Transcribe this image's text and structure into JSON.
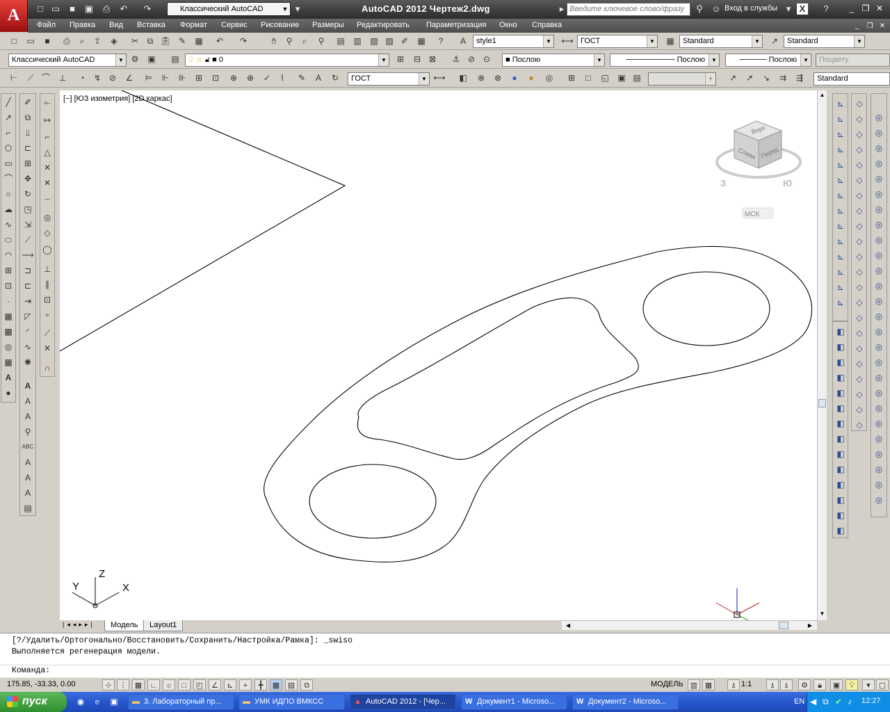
{
  "app": {
    "logo_letter": "A",
    "title": "AutoCAD 2012    Чертеж2.dwg",
    "workspace": "Классический AutoCAD",
    "search_placeholder": "Введите ключевое слово/фразу",
    "login_label": "Вход в службы"
  },
  "menu": [
    "Файл",
    "Правка",
    "Вид",
    "Вставка",
    "Формат",
    "Сервис",
    "Рисование",
    "Размеры",
    "Редактировать",
    "Параметризация",
    "Окно",
    "Справка"
  ],
  "toolbar1": {
    "text_style": "style1",
    "dim_style": "ГОСТ",
    "table_style": "Standard",
    "mleader_style": "Standard"
  },
  "toolbar2": {
    "workspace": "Классический AutoCAD",
    "layer": "0",
    "color": "Послою",
    "linetype": "Послою",
    "lineweight": "Послою",
    "plotstyle": "Поцвету"
  },
  "toolbar3": {
    "dim_style": "ГОСТ",
    "visual": "",
    "mleader": "Standard"
  },
  "viewport": {
    "label": "[−] [ЮЗ изометрия] [2D каркас]",
    "viewcube_top": "Верх",
    "viewcube_left": "Слева",
    "viewcube_front": "Перед",
    "compass_w": "З",
    "compass_s": "Ю",
    "ucs_label": "МСК",
    "axis_x": "X",
    "axis_y": "Y",
    "axis_z": "Z"
  },
  "tabs": [
    "Модель",
    "Layout1"
  ],
  "command": {
    "line1": "[?/Удалить/Ортогонально/Восстановить/Сохранить/Настройка/Рамка]: _swiso",
    "line2": "Выполняется регенерация модели.",
    "prompt": "Команда:"
  },
  "status": {
    "coords": "175.85, -33.33, 0.00",
    "space": "МОДЕЛЬ",
    "scale": "1:1"
  },
  "taskbar": {
    "start": "пуск",
    "tasks": [
      "3. Лабораторный пр...",
      "УМК ИДПО ВМКСС",
      "AutoCAD 2012 - [Чер...",
      "Документ1 - Microso...",
      "Документ2 - Microso..."
    ],
    "lang": "EN",
    "clock": "12:27"
  },
  "colors": {
    "titlebar": "#3c3c3c",
    "taskbar": "#2556cc",
    "start": "#2f8f2f",
    "canvas": "#ffffff"
  }
}
